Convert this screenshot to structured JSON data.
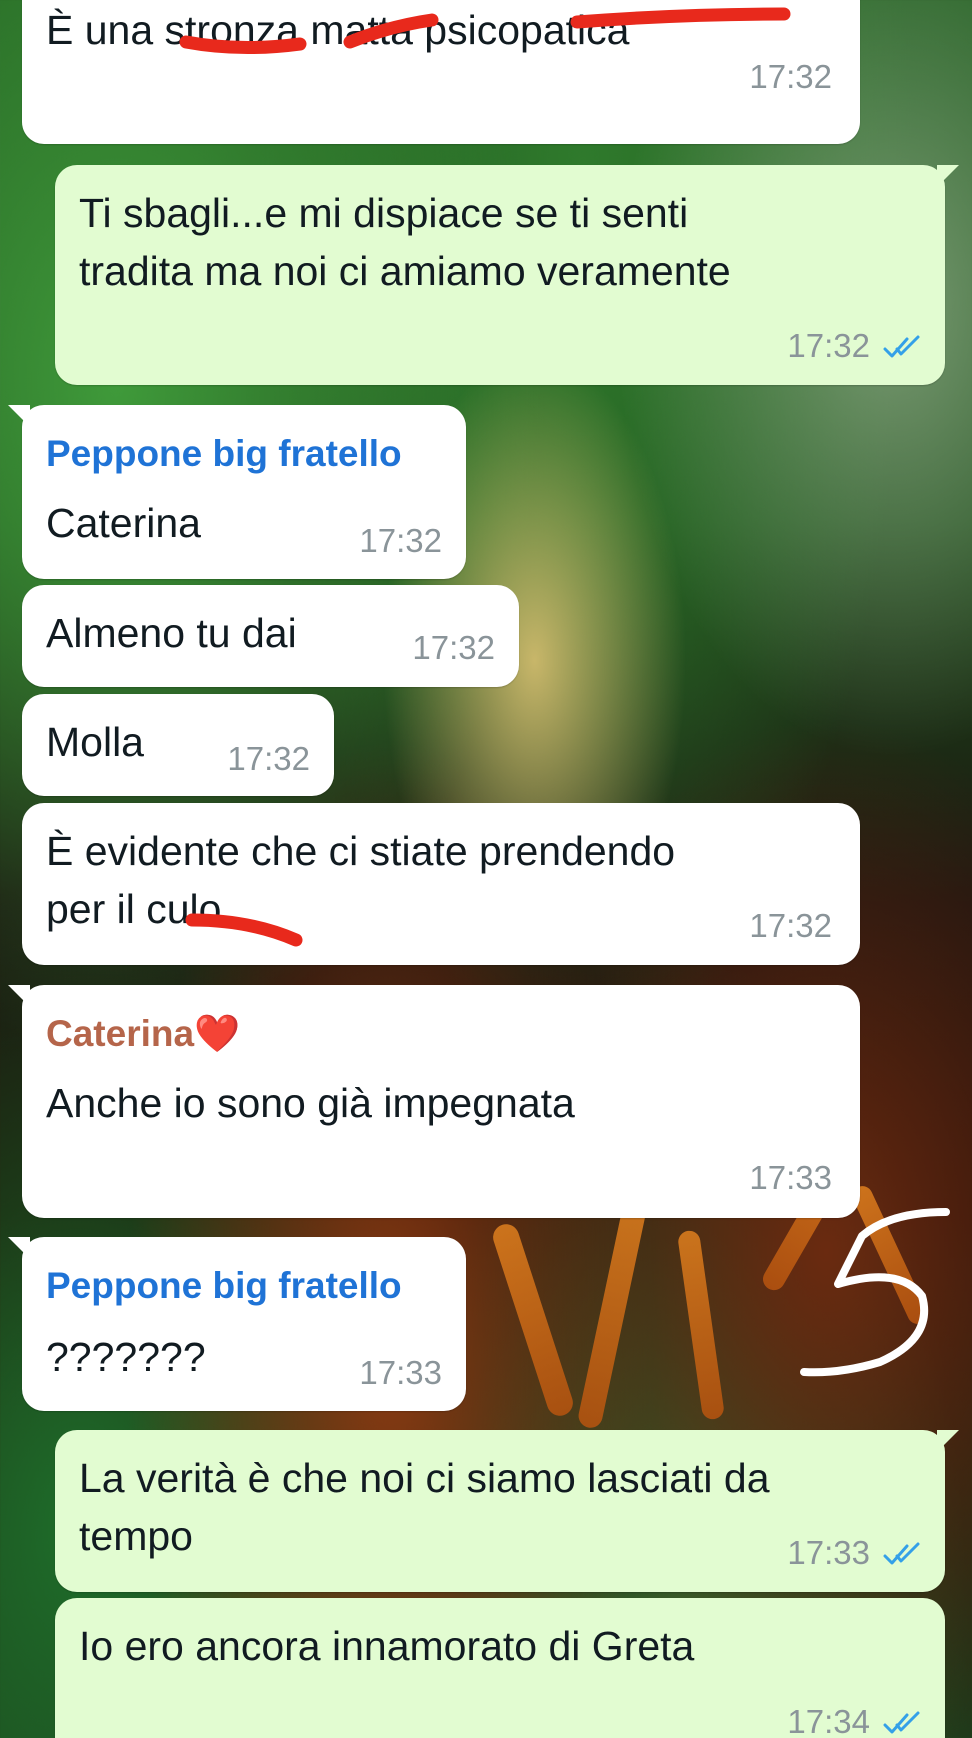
{
  "messages": [
    {
      "text": "È una stronza matta psicopatica",
      "time": "17:32"
    },
    {
      "line1": "Ti sbagli...e mi dispiace se ti senti",
      "line2": "tradita ma noi ci amiamo veramente",
      "time": "17:32",
      "read_icon": "double-check-read-icon"
    },
    {
      "sender": "Peppone big fratello",
      "text": "Caterina",
      "time": "17:32"
    },
    {
      "text": "Almeno tu dai",
      "time": "17:32"
    },
    {
      "text": "Molla",
      "time": "17:32"
    },
    {
      "line1": "È evidente che ci stiate prendendo",
      "line2": "per il culo",
      "time": "17:32"
    },
    {
      "sender": "Caterina",
      "sender_emoji": "❤️",
      "text": "Anche io sono già impegnata",
      "time": "17:33"
    },
    {
      "sender": "Peppone big fratello",
      "text": "???????",
      "time": "17:33"
    },
    {
      "line1": "La verità è che noi ci siamo lasciati da",
      "line2": "tempo",
      "time": "17:33",
      "read_icon": "double-check-read-icon"
    },
    {
      "text": "Io ero ancora innamorato di Greta",
      "time": "17:34",
      "read_icon": "double-check-read-icon"
    }
  ],
  "annotations": {
    "handwritten_mark": "5"
  },
  "colors": {
    "incoming_bubble": "#ffffff",
    "outgoing_bubble": "#e2fcd1",
    "sender_blue": "#1f73d6",
    "sender_brown": "#b5654a",
    "read_ticks": "#34a0e8",
    "redaction_red": "#e8291c"
  }
}
